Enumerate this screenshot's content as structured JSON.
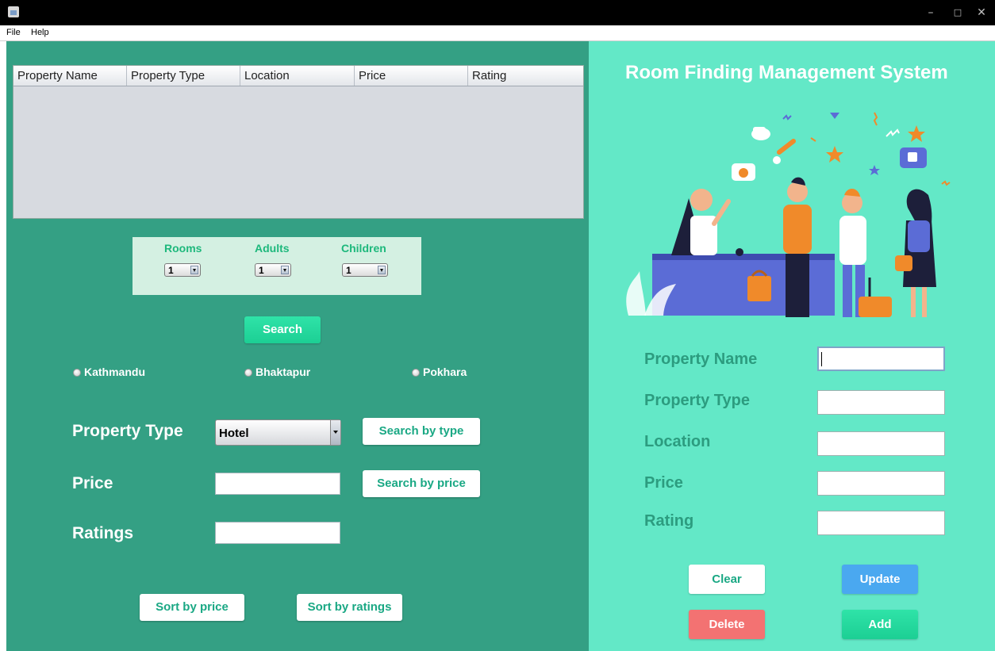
{
  "window": {
    "minimize_glyph": "–",
    "maximize_glyph": "□",
    "close_glyph": "✕"
  },
  "menu": {
    "items": [
      "File",
      "Help"
    ]
  },
  "table": {
    "columns": [
      "Property Name",
      "Property Type",
      "Location",
      "Price",
      "Rating"
    ],
    "rows": []
  },
  "occupancy": {
    "rooms_label": "Rooms",
    "rooms_value": "1",
    "adults_label": "Adults",
    "adults_value": "1",
    "children_label": "Children",
    "children_value": "1"
  },
  "search_button": "Search",
  "locations": [
    "Kathmandu",
    "Bhaktapur",
    "Pokhara"
  ],
  "filters": {
    "property_type_label": "Property Type",
    "property_type_value": "Hotel",
    "search_by_type": "Search by type",
    "price_label": "Price",
    "price_value": "",
    "search_by_price": "Search by price",
    "ratings_label": "Ratings",
    "ratings_value": ""
  },
  "sort": {
    "by_price": "Sort by price",
    "by_ratings": "Sort by ratings"
  },
  "form": {
    "title": "Room Finding Management System",
    "property_name_label": "Property Name",
    "property_type_label": "Property Type",
    "location_label": "Location",
    "price_label": "Price",
    "rating_label": "Rating",
    "values": {
      "property_name": "",
      "property_type": "",
      "location": "",
      "price": "",
      "rating": ""
    }
  },
  "actions": {
    "clear": "Clear",
    "update": "Update",
    "delete": "Delete",
    "add": "Add"
  },
  "colors": {
    "left_panel": "#34a084",
    "right_panel": "#63e8c7",
    "accent_green": "#1ccf94",
    "update_blue": "#4aa8f0",
    "delete_red": "#f37272"
  }
}
